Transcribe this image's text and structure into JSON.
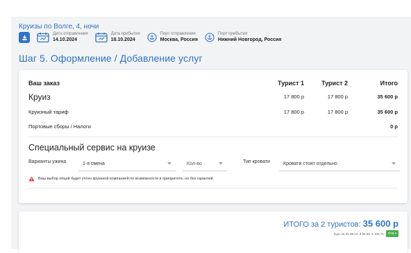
{
  "header": {
    "trip_title": "Круизы по Волге, 4, ночи",
    "departure_date_label": "Дата отправления",
    "departure_date": "14.10.2024",
    "arrival_date_label": "Дата прибытия",
    "arrival_date": "18.10.2024",
    "departure_port_label": "Порт отправления",
    "departure_port": "Москва, Россия",
    "arrival_port_label": "Порт прибытия",
    "arrival_port": "Нижний Новгород, Россия"
  },
  "step_title": "Шаг 5.  Оформление / Добавление услуг",
  "order": {
    "title": "Ваш заказ",
    "col_tourist1": "Турист 1",
    "col_tourist2": "Турист 2",
    "col_total": "Итого",
    "rows": [
      {
        "label": "Круиз",
        "t1": "17 800 р",
        "t2": "17 800 р",
        "total": "35 600 р"
      },
      {
        "label": "Круизный тариф",
        "t1": "17 800 р",
        "t2": "17 800 р",
        "total": "35 600 р"
      },
      {
        "label": "Портовые сборы / Налоги",
        "t1": "",
        "t2": "",
        "total": "0 р"
      }
    ]
  },
  "service": {
    "title": "Специальный сервис на круизе",
    "dinner_label": "Варианты ужина",
    "dinner_value": "1-я смена",
    "qty_value": "Кол-во",
    "bed_label": "Тип кровати",
    "bed_value": "Кровати стоят отдельно",
    "warning": "Ваш выбор опций будет учтен круизной компанией по возможности в приоритете, но без гарантий"
  },
  "summary": {
    "total_label": "ИТОГО за 2 туристов:",
    "total_value": "35 600 р",
    "rate_text": "Курс на 25.08.24: $ 95.85, € 106.70",
    "currency": "РУБ ▾"
  },
  "colors": {
    "accent": "#2f73c4",
    "warning": "#e53935",
    "currency_badge": "#4caf50"
  },
  "icons": [
    "ship-icon",
    "calendar-icon",
    "anchor-icon",
    "warning-icon",
    "chevron-down-icon"
  ]
}
